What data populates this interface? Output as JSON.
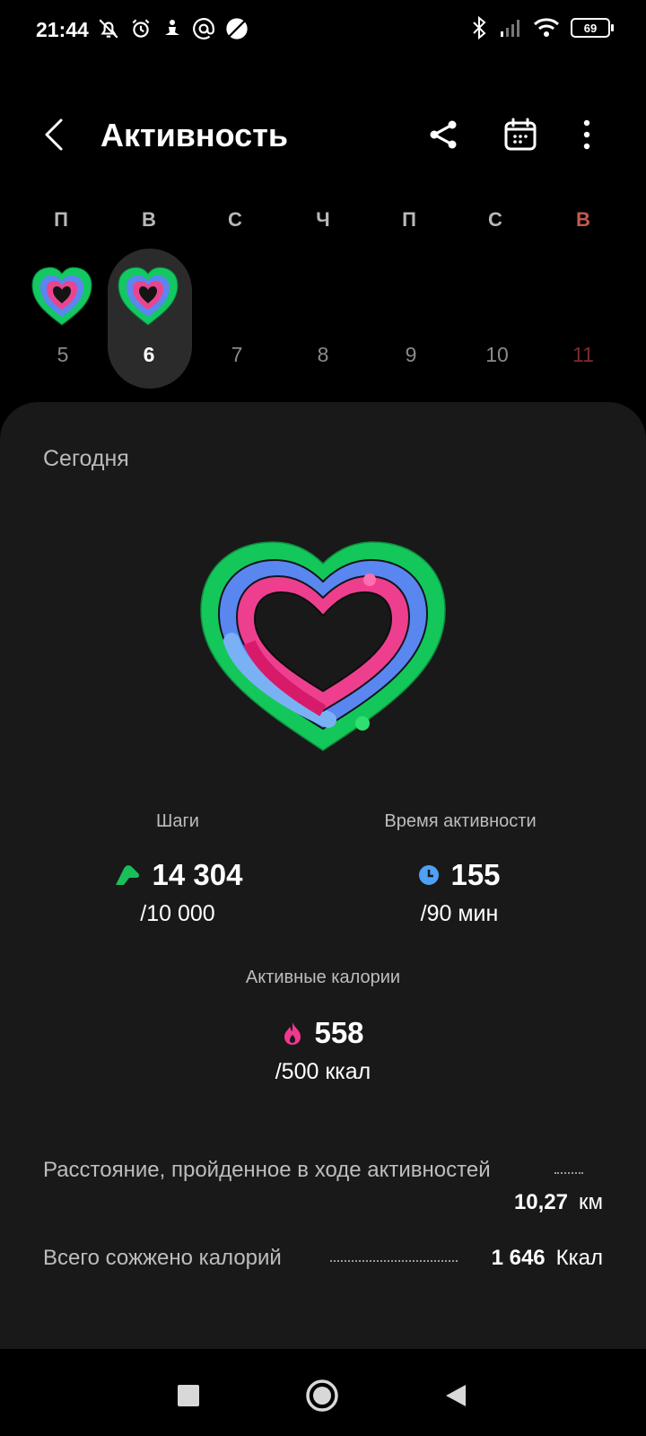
{
  "status_bar": {
    "time": "21:44",
    "battery": "69",
    "icons_left": [
      "bell-off-icon",
      "alarm-icon",
      "meditation-icon",
      "at-icon",
      "planet-icon"
    ],
    "icons_right": [
      "bluetooth-icon",
      "signal-icon",
      "wifi-icon",
      "battery-icon"
    ]
  },
  "app_bar": {
    "title": "Активность",
    "actions": [
      "share-icon",
      "calendar-icon",
      "more-icon"
    ]
  },
  "week": {
    "days": [
      {
        "weekday": "П",
        "date": "5",
        "has_activity": true,
        "selected": false
      },
      {
        "weekday": "В",
        "date": "6",
        "has_activity": true,
        "selected": true
      },
      {
        "weekday": "С",
        "date": "7",
        "has_activity": false,
        "selected": false
      },
      {
        "weekday": "Ч",
        "date": "8",
        "has_activity": false,
        "selected": false
      },
      {
        "weekday": "П",
        "date": "9",
        "has_activity": false,
        "selected": false
      },
      {
        "weekday": "С",
        "date": "10",
        "has_activity": false,
        "selected": false
      },
      {
        "weekday": "В",
        "date": "11",
        "has_activity": false,
        "selected": false
      }
    ]
  },
  "summary": {
    "period_label": "Сегодня",
    "steps": {
      "label": "Шаги",
      "value": "14 304",
      "goal": "/10 000",
      "color": "#19c05a"
    },
    "active_time": {
      "label": "Время активности",
      "value": "155",
      "goal": "/90 мин",
      "color": "#4ea1f5"
    },
    "active_calories": {
      "label": "Активные калории",
      "value": "558",
      "goal": "/500 ккал",
      "color": "#f0388f"
    }
  },
  "details": {
    "distance": {
      "label": "Расстояние, пройденное в ходе активностей",
      "value": "10,27",
      "unit": "км"
    },
    "total_calories": {
      "label": "Всего сожжено калорий",
      "value": "1 646",
      "unit": "Ккал"
    }
  },
  "colors": {
    "ring_green": "#14c75a",
    "ring_blue": "#5a86f0",
    "ring_pink": "#ee3f8f",
    "accent_sunday": "#c5594e",
    "card_bg": "#191919"
  }
}
